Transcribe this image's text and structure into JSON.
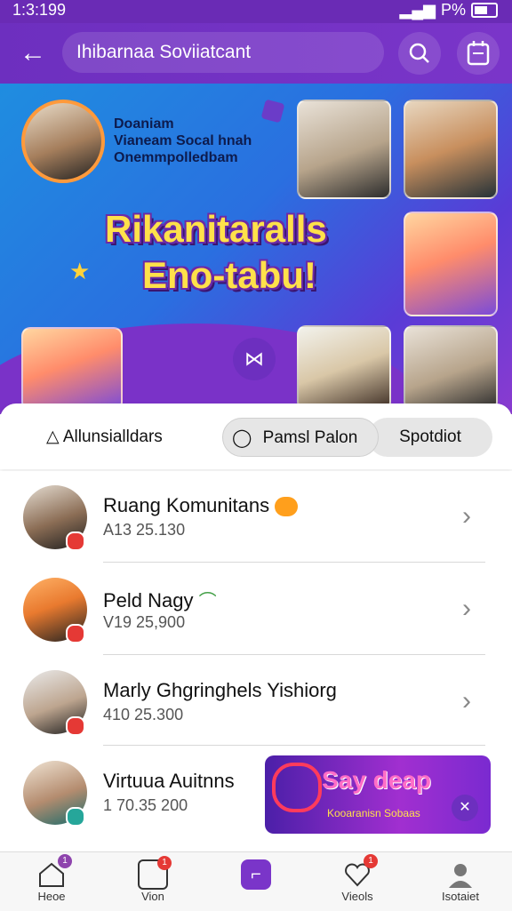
{
  "status": {
    "time": "1:3:199",
    "battery_text": "P%"
  },
  "appbar": {
    "title": "Ihibarnaa Soviiatcant"
  },
  "hero": {
    "intro": [
      "Doaniam",
      "Vianeam Socal hnah",
      "Onemmpolledbam"
    ],
    "headline_line1": "Rikanitaralls",
    "headline_line2": "Eno-tabu!"
  },
  "tabs": [
    {
      "label": "Allunsialldars"
    },
    {
      "label": "Pamsl Palon"
    },
    {
      "label": "Spotdiot"
    }
  ],
  "list": [
    {
      "name": "Ruang Komunitans",
      "sub": "A13 25.130",
      "badge_color": "#e53935"
    },
    {
      "name": "Peld Nagy",
      "sub": "V19 25,900",
      "badge_color": "#e53935"
    },
    {
      "name": "Marly Ghgringhels Yishiorg",
      "sub": "410 25.300",
      "badge_color": "#e53935"
    },
    {
      "name": "Virtuua Auitnns",
      "sub": "1 70.35 200",
      "badge_color": "#26a69a"
    }
  ],
  "promo": {
    "title": "Say deap",
    "subtitle": "Kooaranisn Sobaas"
  },
  "bottom_nav": [
    {
      "label": "Heoe",
      "badge": "1",
      "badge_color": "#8e44ad"
    },
    {
      "label": "Vion",
      "badge": "1",
      "badge_color": "#e53935"
    },
    {
      "label": "",
      "badge": "",
      "badge_color": ""
    },
    {
      "label": "Vieols",
      "badge": "1",
      "badge_color": "#e53935"
    },
    {
      "label": "Isotaiet",
      "badge": "",
      "badge_color": ""
    }
  ],
  "colors": {
    "primary": "#6d2fbf",
    "accent": "#ffe14a"
  }
}
